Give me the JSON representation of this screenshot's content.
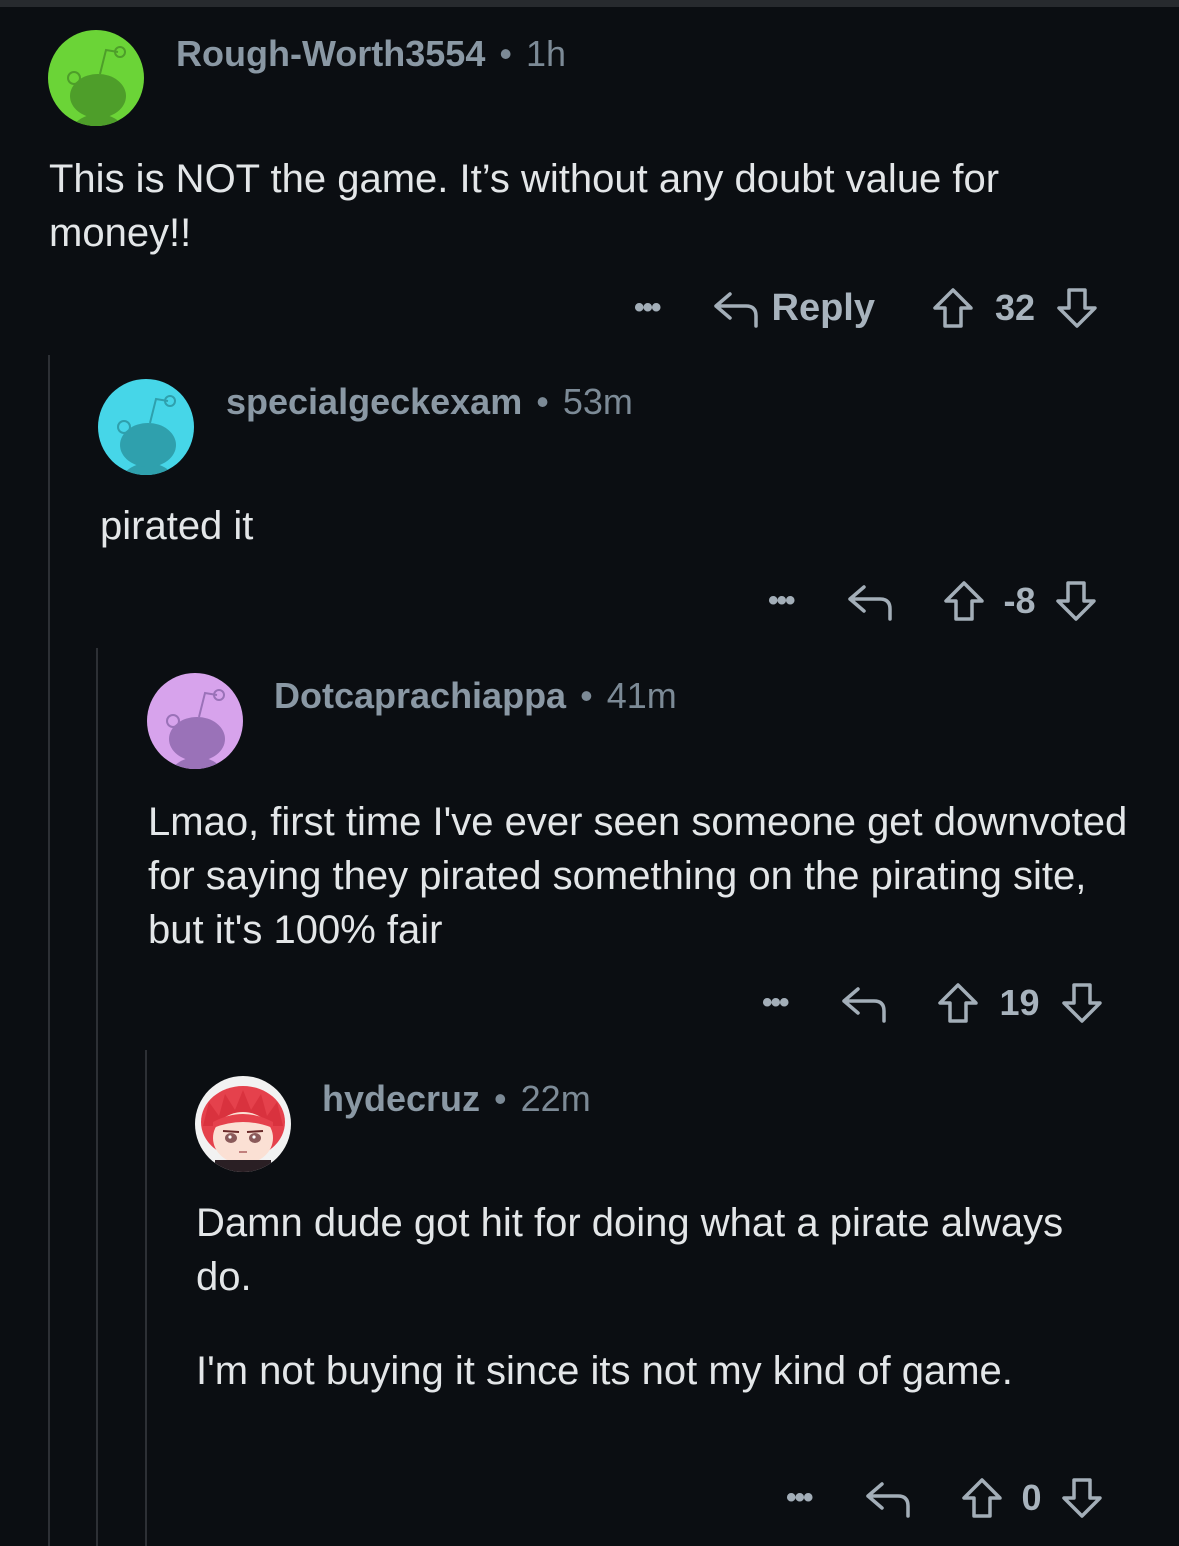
{
  "comments": [
    {
      "username": "Rough-Worth3554",
      "age": "1h",
      "avatar_color": "#6bd437",
      "body": [
        "This is NOT the game. It’s without any doubt value for money!!"
      ],
      "reply_label": "Reply",
      "score": "32"
    },
    {
      "username": "specialgeckexam",
      "age": "53m",
      "avatar_color": "#46d6e8",
      "body": [
        "pirated it"
      ],
      "score": "-8"
    },
    {
      "username": "Dotcaprachiappa",
      "age": "41m",
      "avatar_color": "#d7a3ec",
      "body": [
        "Lmao, first time I've ever seen someone get downvoted for saying they pirated something on the pirating site, but it's 100% fair"
      ],
      "score": "19"
    },
    {
      "username": "hydecruz",
      "age": "22m",
      "avatar_color": "#f0f0f0",
      "body": [
        "Damn dude got hit for doing what a pirate always do.",
        "I'm not buying it since its not my kind of game."
      ],
      "score": "0"
    }
  ],
  "separator": "•",
  "more_label": "•••",
  "icons": {
    "reply": "reply-arrow-icon",
    "upvote": "upvote-arrow-icon",
    "downvote": "downvote-arrow-icon",
    "more": "more-dots-icon"
  }
}
